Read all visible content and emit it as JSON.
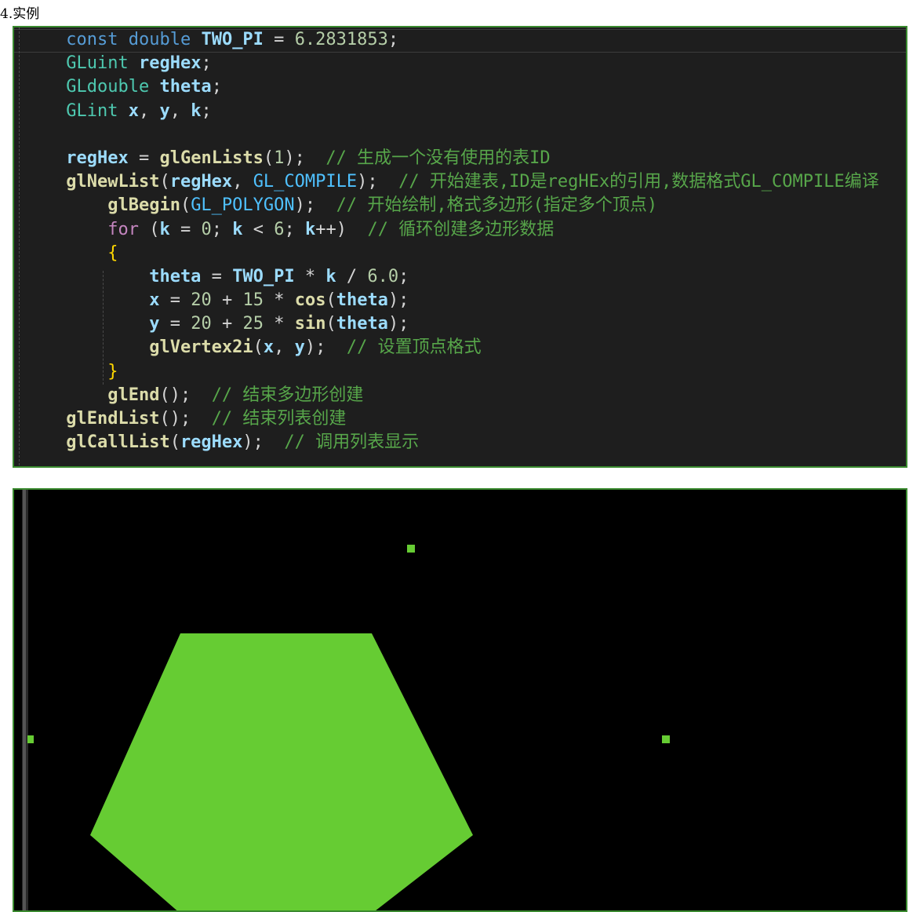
{
  "heading": "4.实例",
  "code": {
    "lines": [
      [
        {
          "t": "const",
          "c": "kw"
        },
        {
          "t": " ",
          "c": "op"
        },
        {
          "t": "double",
          "c": "kw"
        },
        {
          "t": " ",
          "c": "op"
        },
        {
          "t": "TWO_PI",
          "c": "var"
        },
        {
          "t": " = ",
          "c": "op"
        },
        {
          "t": "6.2831853",
          "c": "num"
        },
        {
          "t": ";",
          "c": "op"
        }
      ],
      [
        {
          "t": "GLuint",
          "c": "type"
        },
        {
          "t": " ",
          "c": "op"
        },
        {
          "t": "regHex",
          "c": "var"
        },
        {
          "t": ";",
          "c": "op"
        }
      ],
      [
        {
          "t": "GLdouble",
          "c": "type"
        },
        {
          "t": " ",
          "c": "op"
        },
        {
          "t": "theta",
          "c": "var"
        },
        {
          "t": ";",
          "c": "op"
        }
      ],
      [
        {
          "t": "GLint",
          "c": "type"
        },
        {
          "t": " ",
          "c": "op"
        },
        {
          "t": "x",
          "c": "var"
        },
        {
          "t": ", ",
          "c": "op"
        },
        {
          "t": "y",
          "c": "var"
        },
        {
          "t": ", ",
          "c": "op"
        },
        {
          "t": "k",
          "c": "var"
        },
        {
          "t": ";",
          "c": "op"
        }
      ],
      [],
      [
        {
          "t": "regHex",
          "c": "var"
        },
        {
          "t": " = ",
          "c": "op"
        },
        {
          "t": "glGenLists",
          "c": "fn"
        },
        {
          "t": "(",
          "c": "op"
        },
        {
          "t": "1",
          "c": "num"
        },
        {
          "t": ");  ",
          "c": "op"
        },
        {
          "t": "// 生成一个没有使用的表ID",
          "c": "cm"
        }
      ],
      [
        {
          "t": "glNewList",
          "c": "fn"
        },
        {
          "t": "(",
          "c": "op"
        },
        {
          "t": "regHex",
          "c": "var"
        },
        {
          "t": ", ",
          "c": "op"
        },
        {
          "t": "GL_COMPILE",
          "c": "const"
        },
        {
          "t": ");  ",
          "c": "op"
        },
        {
          "t": "// 开始建表,ID是regHEx的引用,数据格式GL_COMPILE编译",
          "c": "cm"
        }
      ],
      [
        {
          "t": "    ",
          "c": "op"
        },
        {
          "t": "glBegin",
          "c": "fn"
        },
        {
          "t": "(",
          "c": "op"
        },
        {
          "t": "GL_POLYGON",
          "c": "const"
        },
        {
          "t": ");  ",
          "c": "op"
        },
        {
          "t": "// 开始绘制,格式多边形(指定多个顶点)",
          "c": "cm"
        }
      ],
      [
        {
          "t": "    ",
          "c": "op"
        },
        {
          "t": "for",
          "c": "ctrl"
        },
        {
          "t": " (",
          "c": "op"
        },
        {
          "t": "k",
          "c": "var"
        },
        {
          "t": " = ",
          "c": "op"
        },
        {
          "t": "0",
          "c": "num"
        },
        {
          "t": "; ",
          "c": "op"
        },
        {
          "t": "k",
          "c": "var"
        },
        {
          "t": " < ",
          "c": "op"
        },
        {
          "t": "6",
          "c": "num"
        },
        {
          "t": "; ",
          "c": "op"
        },
        {
          "t": "k",
          "c": "var"
        },
        {
          "t": "++)  ",
          "c": "op"
        },
        {
          "t": "// 循环创建多边形数据",
          "c": "cm"
        }
      ],
      [
        {
          "t": "    ",
          "c": "op"
        },
        {
          "t": "{",
          "c": "brace"
        }
      ],
      [
        {
          "t": "        ",
          "c": "op"
        },
        {
          "t": "theta",
          "c": "var"
        },
        {
          "t": " = ",
          "c": "op"
        },
        {
          "t": "TWO_PI",
          "c": "var"
        },
        {
          "t": " * ",
          "c": "op"
        },
        {
          "t": "k",
          "c": "var"
        },
        {
          "t": " / ",
          "c": "op"
        },
        {
          "t": "6.0",
          "c": "num"
        },
        {
          "t": ";",
          "c": "op"
        }
      ],
      [
        {
          "t": "        ",
          "c": "op"
        },
        {
          "t": "x",
          "c": "var"
        },
        {
          "t": " = ",
          "c": "op"
        },
        {
          "t": "20",
          "c": "num"
        },
        {
          "t": " + ",
          "c": "op"
        },
        {
          "t": "15",
          "c": "num"
        },
        {
          "t": " * ",
          "c": "op"
        },
        {
          "t": "cos",
          "c": "fn"
        },
        {
          "t": "(",
          "c": "op"
        },
        {
          "t": "theta",
          "c": "var"
        },
        {
          "t": ");",
          "c": "op"
        }
      ],
      [
        {
          "t": "        ",
          "c": "op"
        },
        {
          "t": "y",
          "c": "var"
        },
        {
          "t": " = ",
          "c": "op"
        },
        {
          "t": "20",
          "c": "num"
        },
        {
          "t": " + ",
          "c": "op"
        },
        {
          "t": "25",
          "c": "num"
        },
        {
          "t": " * ",
          "c": "op"
        },
        {
          "t": "sin",
          "c": "fn"
        },
        {
          "t": "(",
          "c": "op"
        },
        {
          "t": "theta",
          "c": "var"
        },
        {
          "t": ");",
          "c": "op"
        }
      ],
      [
        {
          "t": "        ",
          "c": "op"
        },
        {
          "t": "glVertex2i",
          "c": "fn"
        },
        {
          "t": "(",
          "c": "op"
        },
        {
          "t": "x",
          "c": "var"
        },
        {
          "t": ", ",
          "c": "op"
        },
        {
          "t": "y",
          "c": "var"
        },
        {
          "t": ");  ",
          "c": "op"
        },
        {
          "t": "// 设置顶点格式",
          "c": "cm"
        }
      ],
      [
        {
          "t": "    ",
          "c": "op"
        },
        {
          "t": "}",
          "c": "brace"
        }
      ],
      [
        {
          "t": "    ",
          "c": "op"
        },
        {
          "t": "glEnd",
          "c": "fn"
        },
        {
          "t": "();  ",
          "c": "op"
        },
        {
          "t": "// 结束多边形创建",
          "c": "cm"
        }
      ],
      [
        {
          "t": "glEndList",
          "c": "fn"
        },
        {
          "t": "();  ",
          "c": "op"
        },
        {
          "t": "// 结束列表创建",
          "c": "cm"
        }
      ],
      [
        {
          "t": "glCallList",
          "c": "fn"
        },
        {
          "t": "(",
          "c": "op"
        },
        {
          "t": "regHex",
          "c": "var"
        },
        {
          "t": ");  ",
          "c": "op"
        },
        {
          "t": "// 调用列表显示",
          "c": "cm"
        }
      ]
    ]
  },
  "output": {
    "background": "#000000",
    "fill": "#66cc33"
  }
}
